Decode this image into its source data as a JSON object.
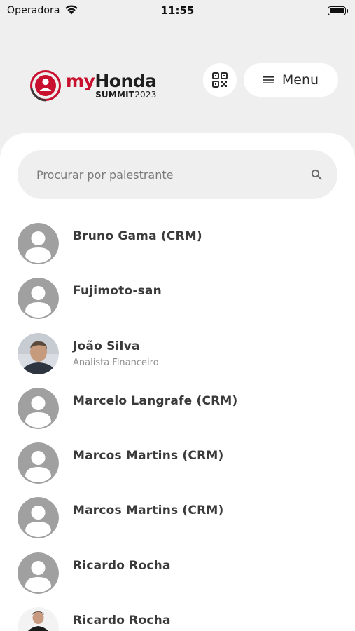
{
  "status_bar": {
    "carrier": "Operadora",
    "time": "11:55"
  },
  "header": {
    "logo": {
      "title_my": "my",
      "title_honda": "Honda",
      "subtitle_summit": "SUMMIT",
      "subtitle_year": "2023"
    },
    "menu_label": "Menu"
  },
  "search": {
    "placeholder": "Procurar por palestrante",
    "value": ""
  },
  "speakers": [
    {
      "name": "Bruno Gama (CRM)",
      "role": "",
      "avatar": "placeholder"
    },
    {
      "name": "Fujimoto-san",
      "role": "",
      "avatar": "placeholder"
    },
    {
      "name": "João Silva",
      "role": "Analista Financeiro",
      "avatar": "photo"
    },
    {
      "name": "Marcelo Langrafe (CRM)",
      "role": "",
      "avatar": "placeholder"
    },
    {
      "name": "Marcos Martins (CRM)",
      "role": "",
      "avatar": "placeholder"
    },
    {
      "name": "Marcos Martins (CRM)",
      "role": "",
      "avatar": "placeholder"
    },
    {
      "name": "Ricardo Rocha",
      "role": "",
      "avatar": "placeholder"
    },
    {
      "name": "Ricardo Rocha",
      "role": "",
      "avatar": "photo-dark"
    }
  ],
  "colors": {
    "brand_red": "#c8102e",
    "background": "#efefef",
    "card": "#ffffff",
    "placeholder_avatar": "#a0a0a0"
  },
  "icons": {
    "wifi": "wifi-icon",
    "battery": "battery-icon",
    "qr": "qr-code-icon",
    "menu": "hamburger-icon",
    "search": "search-icon"
  }
}
